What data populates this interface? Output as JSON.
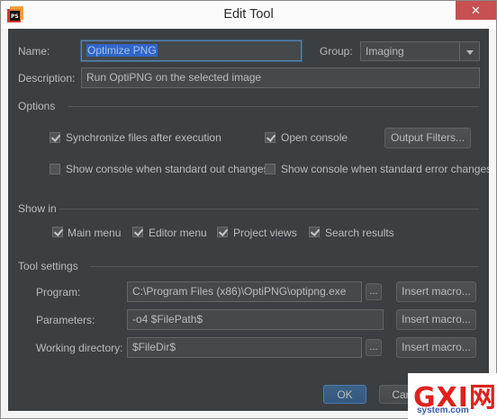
{
  "window": {
    "title": "Edit Tool",
    "close_glyph": "✕"
  },
  "general": {
    "name_label": "Name:",
    "name_value": "Optimize PNG",
    "group_label": "Group:",
    "group_value": "Imaging",
    "description_label": "Description:",
    "description_value": "Run OptiPNG on the selected image"
  },
  "options": {
    "section_label": "Options",
    "sync_files": {
      "label": "Synchronize files after execution",
      "checked": true
    },
    "open_console": {
      "label": "Open console",
      "checked": true
    },
    "output_filters_button": "Output Filters...",
    "console_stdout": {
      "label": "Show console when standard out changes",
      "checked": false
    },
    "console_stderr": {
      "label": "Show console when standard error changes",
      "checked": false
    }
  },
  "show_in": {
    "section_label": "Show in",
    "main_menu": {
      "label": "Main menu",
      "checked": true
    },
    "editor_menu": {
      "label": "Editor menu",
      "checked": true
    },
    "project_views": {
      "label": "Project views",
      "checked": true
    },
    "search_results": {
      "label": "Search results",
      "checked": true
    }
  },
  "tool_settings": {
    "section_label": "Tool settings",
    "program_label": "Program:",
    "program_value": "C:\\Program Files (x86)\\OptiPNG\\optipng.exe",
    "parameters_label": "Parameters:",
    "parameters_value": "-o4 $FilePath$",
    "working_dir_label": "Working directory:",
    "working_dir_value": "$FileDir$",
    "browse_label": "...",
    "insert_macro_label": "Insert macro..."
  },
  "buttons": {
    "ok": "OK",
    "cancel": "Cancel"
  },
  "watermark": {
    "logo_text": "GXI网",
    "sub_text": "system.com"
  }
}
